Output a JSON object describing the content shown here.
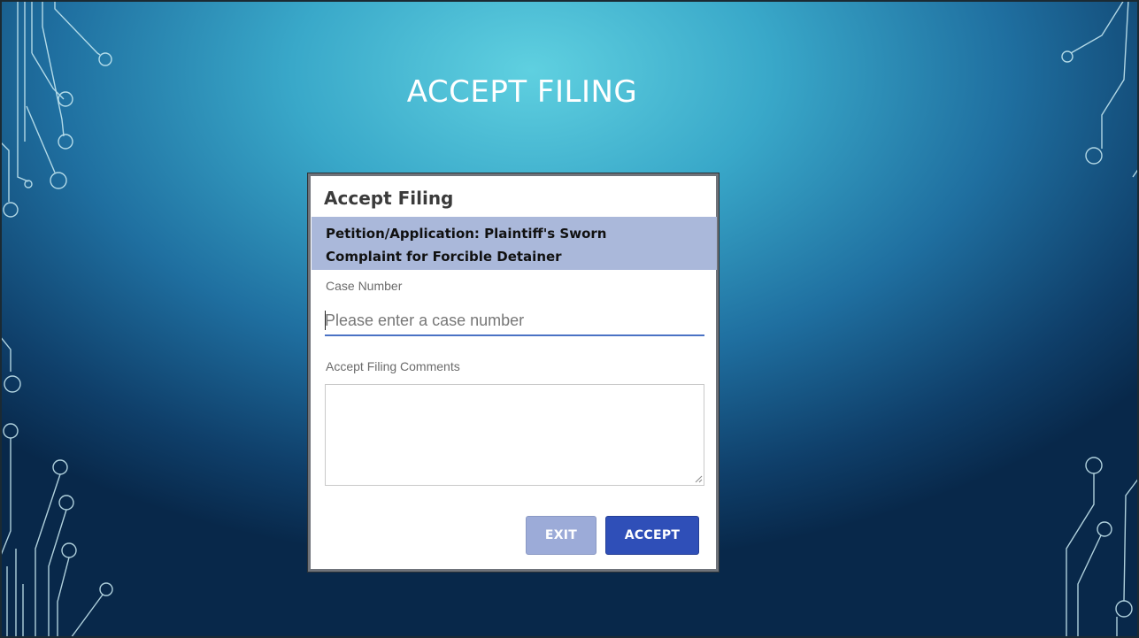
{
  "slide": {
    "title": "ACCEPT FILING"
  },
  "dialog": {
    "title": "Accept Filing",
    "banner_lines": [
      "Petition/Application: Plaintiff's Sworn",
      "Complaint for Forcible Detainer"
    ],
    "case_number_label": "Case Number",
    "case_number_placeholder": "Please enter a case number",
    "case_number_value": "",
    "comments_label": "Accept Filing Comments",
    "comments_value": "",
    "exit_label": "EXIT",
    "accept_label": "ACCEPT"
  },
  "colors": {
    "banner": "#aab8da",
    "accept_button": "#2f4fb8",
    "exit_button": "#9cabd8",
    "input_underline": "#4a72c4"
  },
  "icons": [
    "circuit-trace-decoration",
    "resize-grip-icon",
    "text-cursor"
  ]
}
